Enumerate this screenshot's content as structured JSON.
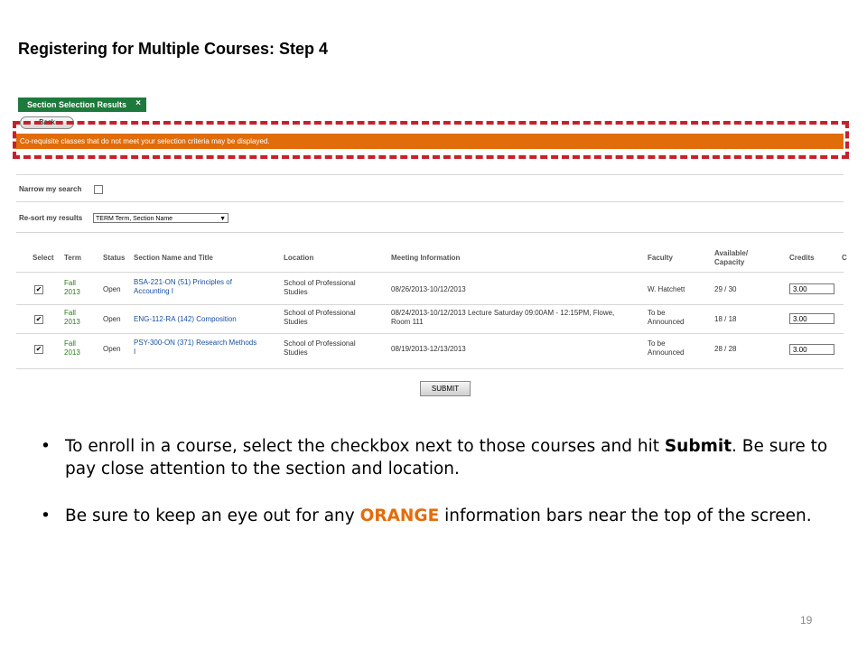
{
  "slide": {
    "title": "Registering for Multiple Courses: Step 4",
    "page_number": "19"
  },
  "screenshot": {
    "tab_title": "Section Selection Results",
    "tab_close": "×",
    "back_label": "Back",
    "info_bar": "Co-requisite classes that do not meet your selection criteria may be displayed.",
    "narrow_label": "Narrow my search",
    "resort_label": "Re-sort my results",
    "resort_value": "TERM Term, Section Name",
    "resort_arrow": "▼",
    "columns": {
      "select": "Select",
      "term": "Term",
      "status": "Status",
      "section": "Section Name and Title",
      "location": "Location",
      "meeting": "Meeting Information",
      "faculty": "Faculty",
      "avail_1": "Available/",
      "avail_2": "Capacity",
      "credits": "Credits",
      "extra": "C"
    },
    "rows": [
      {
        "checked": "✔",
        "term_1": "Fall",
        "term_2": "2013",
        "status": "Open",
        "section_1": "BSA-221-ON (51) Principles of",
        "section_2": "Accounting I",
        "location_1": "School of Professional",
        "location_2": "Studies",
        "meeting_1": "08/26/2013-10/12/2013",
        "meeting_2": "",
        "faculty_1": "W. Hatchett",
        "faculty_2": "",
        "availability": "29 / 30",
        "credits": "3.00"
      },
      {
        "checked": "✔",
        "term_1": "Fall",
        "term_2": "2013",
        "status": "Open",
        "section_1": "ENG-112-RA (142) Composition",
        "section_2": "",
        "location_1": "School of Professional",
        "location_2": "Studies",
        "meeting_1": "08/24/2013-10/12/2013 Lecture Saturday 09:00AM - 12:15PM, Flowe,",
        "meeting_2": "Room 111",
        "faculty_1": "To be",
        "faculty_2": "Announced",
        "availability": "18 / 18",
        "credits": "3.00"
      },
      {
        "checked": "✔",
        "term_1": "Fall",
        "term_2": "2013",
        "status": "Open",
        "section_1": "PSY-300-ON (371) Research Methods",
        "section_2": "I",
        "location_1": "School of Professional",
        "location_2": "Studies",
        "meeting_1": "08/19/2013-12/13/2013",
        "meeting_2": "",
        "faculty_1": "To be",
        "faculty_2": "Announced",
        "availability": "28 / 28",
        "credits": "3.00"
      }
    ],
    "submit_label": "SUBMIT"
  },
  "bullets": {
    "dot": "•",
    "b1_text1": "To enroll in a course, select the checkbox next to those courses and hit ",
    "b1_bold": "Submit",
    "b1_text2": ".  Be sure to pay close attention to the section and location.",
    "b2_text1": "Be sure to keep an eye out for any ",
    "b2_orange": "ORANGE",
    "b2_text2": " information bars near the top of the screen."
  },
  "colors": {
    "tab_green": "#1e7a3c",
    "info_orange": "#e06c0a",
    "highlight_red": "#c8202a",
    "link_blue": "#1a4fa3"
  }
}
